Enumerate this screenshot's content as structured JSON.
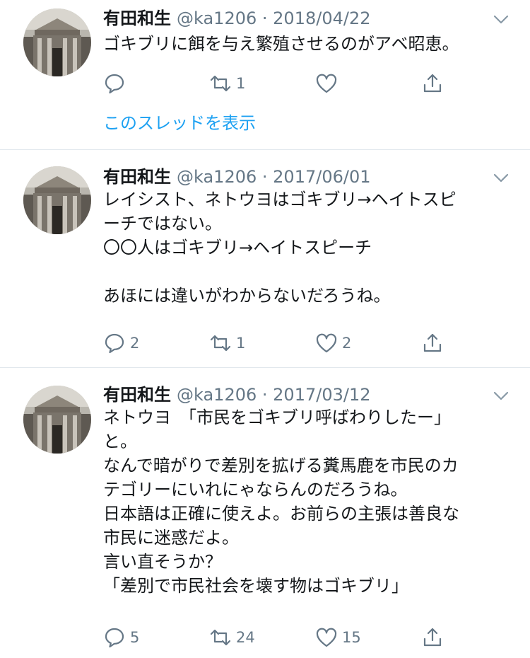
{
  "colors": {
    "accent": "#1da1f2",
    "muted": "#657786",
    "text": "#14171a",
    "divider": "#e1e8ed"
  },
  "tweets": [
    {
      "name": "有田和生",
      "meta": "@ka1206 · 2018/04/22",
      "text": "ゴキブリに餌を与え繁殖させるのがアベ昭恵。",
      "reply_count": "",
      "retweet_count": "1",
      "like_count": "",
      "thread_link": "このスレッドを表示"
    },
    {
      "name": "有田和生",
      "meta": "@ka1206 · 2017/06/01",
      "text": "レイシスト、ネトウヨはゴキブリ→ヘイトスピ\nーチではない。\n〇〇人はゴキブリ→ヘイトスピーチ\n\nあほには違いがわからないだろうね。",
      "reply_count": "2",
      "retweet_count": "1",
      "like_count": "2"
    },
    {
      "name": "有田和生",
      "meta": "@ka1206 · 2017/03/12",
      "text": "ネトウヨ　「市民をゴキブリ呼ばわりしたー」\nと。\nなんで暗がりで差別を拡げる糞馬鹿を市民のカ\nテゴリーにいれにゃならんのだろうね。\n日本語は正確に使えよ。お前らの主張は善良な\n市民に迷惑だよ。\n言い直そうか？\n「差別で市民社会を壊す物はゴキブリ」",
      "reply_count": "5",
      "retweet_count": "24",
      "like_count": "15"
    }
  ]
}
